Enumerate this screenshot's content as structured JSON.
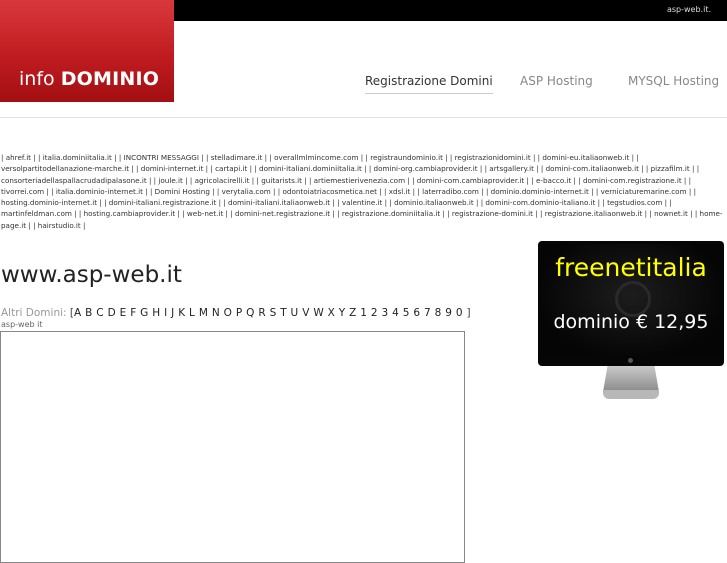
{
  "topbar": {
    "site": "asp-web.it."
  },
  "logo": {
    "prefix": "info",
    "brand": "DOMINIO"
  },
  "nav": [
    {
      "label": "Registrazione Domini",
      "active": true
    },
    {
      "label": "ASP Hosting",
      "active": false
    },
    {
      "label": "MYSQL Hosting",
      "active": false
    }
  ],
  "links": [
    "ahref.it",
    "italia.dominiitalia.it",
    "INCONTRI MESSAGGI",
    "stelladimare.it",
    "overallmlmincome.com",
    "registraundominio.it",
    "registrazionidomini.it",
    "domini-eu.italiaonweb.it",
    "versolpartitodellanazione-marche.it",
    "domini-internet.it",
    "cartapi.it",
    "domini-italiani.dominiitalia.it",
    "domini-org.cambiaprovider.it",
    "artsgallery.it",
    "domini-com.italiaonweb.it",
    "pizzafilm.it",
    "consorteriadellaspallacrudadipalasone.it",
    "joule.it",
    "agricolacirelli.it",
    "guitarists.it",
    "artiemestierivenezia.com",
    "domini-com.cambiaprovider.it",
    "e-bacco.it",
    "domini-com.registrazione.it",
    "tivorrei.com",
    "italia.dominio-internet.it",
    "Domini Hosting",
    "verytalia.com",
    "odontoiatriacosmetica.net",
    "xdsl.it",
    "laterradibo.com",
    "dominio.dominio-internet.it",
    "verniciaturemarine.com",
    "hosting.dominio-internet.it",
    "domini-italiani.registrazione.it",
    "domini-italiani.italiaonweb.it",
    "valentine.it",
    "dominio.italiaonweb.it",
    "domini-com.dominio-italiano.it",
    "tegstudios.com",
    "martinfeldman.com",
    "hosting.cambiaprovider.it",
    "web-net.it",
    "domini-net.registrazione.it",
    "registrazione.dominiitalia.it",
    "registrazione-domini.it",
    "registrazione.italiaonweb.it",
    "nownet.it",
    "home-page.it",
    "hairstudio.it"
  ],
  "main": {
    "title": "www.asp-web.it",
    "altri_label": "Altri Domini:",
    "letters": [
      "A",
      "B",
      "C",
      "D",
      "E",
      "F",
      "G",
      "H",
      "I",
      "J",
      "K",
      "L",
      "M",
      "N",
      "O",
      "P",
      "Q",
      "R",
      "S",
      "T",
      "U",
      "V",
      "W",
      "X",
      "Y",
      "Z",
      "1",
      "2",
      "3",
      "4",
      "5",
      "6",
      "7",
      "8",
      "9",
      "0"
    ],
    "subtitle": "asp-web it"
  },
  "ad": {
    "brand": "freenetitalia",
    "price": "dominio € 12,95",
    "brand_color": "#ffff00"
  }
}
